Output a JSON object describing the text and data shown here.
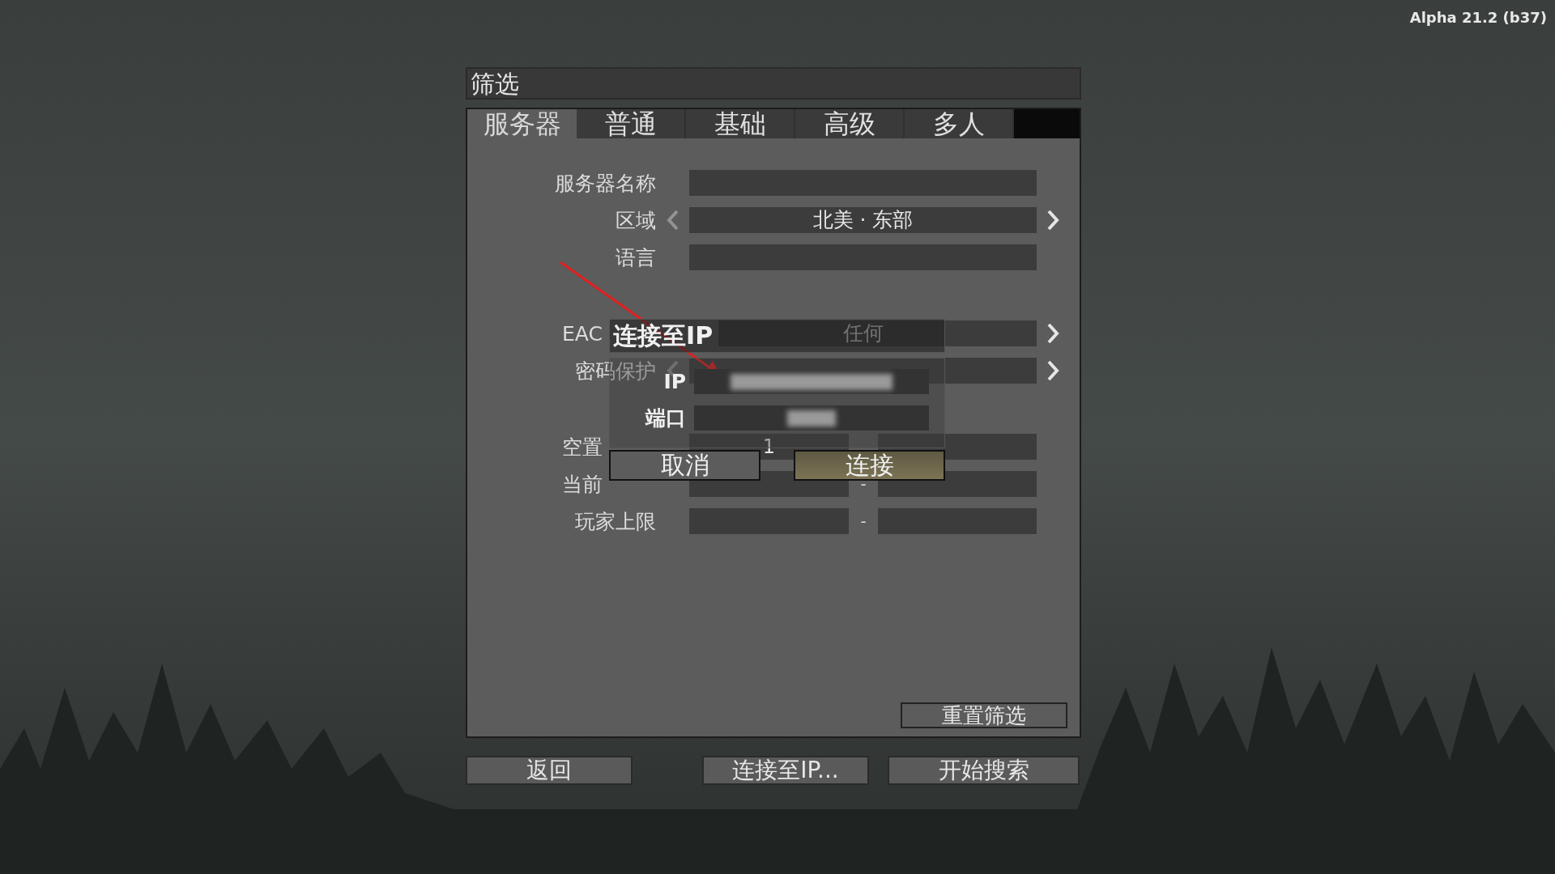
{
  "version": "Alpha 21.2 (b37)",
  "filter": {
    "title": "筛选",
    "tabs": [
      {
        "label": "服务器",
        "selected": true
      },
      {
        "label": "普通",
        "selected": false
      },
      {
        "label": "基础",
        "selected": false
      },
      {
        "label": "高级",
        "selected": false
      },
      {
        "label": "多人",
        "selected": false
      }
    ],
    "groups": [
      [
        {
          "kind": "text",
          "label": "服务器名称"
        },
        {
          "kind": "select",
          "label": "区域",
          "value": "北美 · 东部",
          "left_arrow": true
        },
        {
          "kind": "text",
          "label": "语言"
        }
      ],
      [
        {
          "kind": "select",
          "label": "EAC",
          "value": "任何",
          "clipped": true
        },
        {
          "kind": "select",
          "label": "密码保护",
          "left_arrow": true
        }
      ],
      [
        {
          "kind": "range",
          "label": "空置",
          "min": "1",
          "clipped": true
        },
        {
          "kind": "range",
          "label": "当前",
          "separator": "-",
          "clipped": true
        },
        {
          "kind": "range",
          "label": "玩家上限",
          "separator": "-"
        }
      ]
    ],
    "reset_button": "重置筛选"
  },
  "bottom_buttons": [
    "返回",
    "连接至IP...",
    "开始搜索"
  ],
  "dialog": {
    "title": "连接至IP",
    "fields": [
      {
        "label": "IP"
      },
      {
        "label": "端口"
      }
    ],
    "buttons": [
      {
        "label": "取消",
        "primary": false
      },
      {
        "label": "连接",
        "primary": true
      }
    ]
  }
}
